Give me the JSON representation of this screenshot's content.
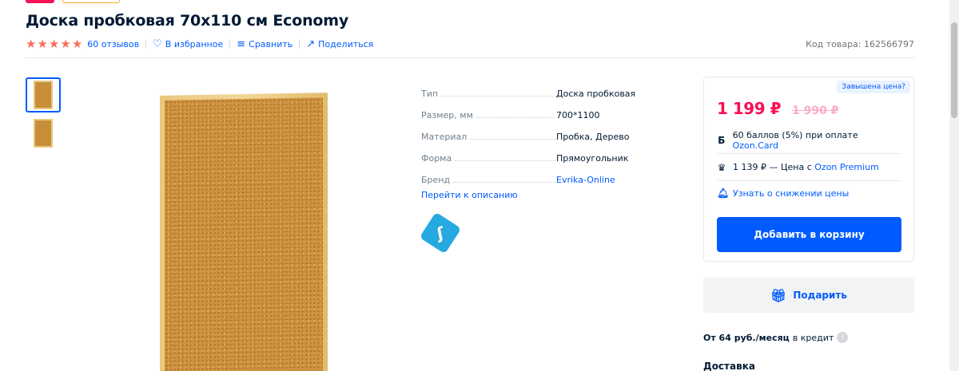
{
  "product": {
    "title": "Доска пробковая 70x110 см Economy",
    "rating_stars": 4.5,
    "reviews": "60 отзывов",
    "favorite": "В избранное",
    "compare": "Сравнить",
    "share": "Поделиться",
    "sku": "Код товара: 162566797"
  },
  "specs": [
    {
      "key": "Тип",
      "value": "Доска пробковая"
    },
    {
      "key": "Размер, мм",
      "value": "700*1100"
    },
    {
      "key": "Материал",
      "value": "Пробка, Дерево"
    },
    {
      "key": "Форма",
      "value": "Прямоугольник"
    },
    {
      "key": "Бренд",
      "value": "Evrika-Online"
    }
  ],
  "goto_description": "Перейти к описанию",
  "price_card": {
    "alert": "Завышена цена?",
    "price_now": "1 199 ₽",
    "price_old": "1 990 ₽",
    "bonus_icon": "Б",
    "bonus_text": "60 баллов (5%) при оплате",
    "bonus_link": "Ozon.Card",
    "premium_text": "1 139 ₽ — Цена с",
    "premium_link": "Ozon Premium",
    "notify": "Узнать о снижении цены",
    "cart_button": "Добавить в корзину"
  },
  "gift_button": "Подарить",
  "credit": {
    "amount": "От 64 руб./месяц",
    "suffix": "в кредит"
  },
  "delivery": "Доставка",
  "colors": {
    "accent": "#005bff",
    "price": "#f91155",
    "stars": "#f4705c"
  }
}
